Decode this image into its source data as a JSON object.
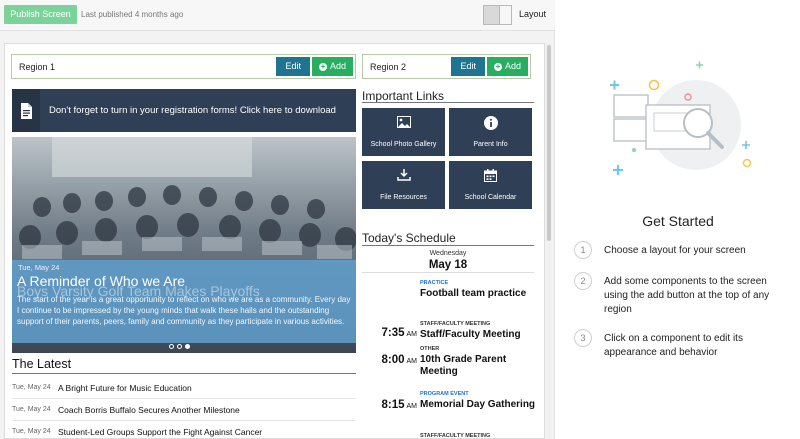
{
  "toolbar": {
    "publish_label": "Publish Screen",
    "last_published": "Last published 4 months ago",
    "layout_label": "Layout"
  },
  "regions": [
    {
      "title": "Region 1",
      "edit_label": "Edit",
      "add_label": "Add"
    },
    {
      "title": "Region 2",
      "edit_label": "Edit",
      "add_label": "Add"
    }
  ],
  "announcement": {
    "text": "Don't forget to turn in your registration forms! Click here to download",
    "icon": "document-icon"
  },
  "slideshow": {
    "date": "Tue, May 24",
    "title": "A Reminder of Who we Are",
    "title_ghost": "Boys Varsity Golf Team Makes Playoffs",
    "body": "The start of the year is a great opportunity to reflect on who we are as a community. Every day I continue to be impressed by the young minds that walk these halls and the outstanding support of their parents, peers, family and community as they participate in various activities.",
    "dots": 3,
    "active_dot": 3
  },
  "latest": {
    "heading": "The Latest",
    "items": [
      {
        "date": "Tue, May 24",
        "title": "A Bright Future for Music Education"
      },
      {
        "date": "Tue, May 24",
        "title": "Coach Borris Buffalo Secures Another Milestone"
      },
      {
        "date": "Tue, May 24",
        "title": "Student-Led Groups Support the Fight Against Cancer"
      }
    ]
  },
  "important_links": {
    "heading": "Important Links",
    "tiles": [
      {
        "label": "School Photo Gallery",
        "icon": "photo-icon"
      },
      {
        "label": "Parent Info",
        "icon": "info-icon"
      },
      {
        "label": "File Resources",
        "icon": "download-icon"
      },
      {
        "label": "School Calendar",
        "icon": "calendar-icon"
      }
    ]
  },
  "schedule": {
    "heading": "Today's Schedule",
    "day": "Wednesday",
    "date": "May 18",
    "events": [
      {
        "time": "",
        "ampm": "",
        "category": "PRACTICE",
        "category_color": "#1a73c8",
        "name": "Football team practice"
      },
      {
        "time": "7:35",
        "ampm": "AM",
        "category": "STAFF/FACULTY MEETING",
        "category_color": "#333333",
        "name": "Staff/Faculty Meeting"
      },
      {
        "time": "8:00",
        "ampm": "AM",
        "category": "OTHER",
        "category_color": "#333333",
        "name": "10th Grade Parent Meeting"
      },
      {
        "time": "8:15",
        "ampm": "AM",
        "category": "PROGRAM EVENT",
        "category_color": "#1a73c8",
        "name": "Memorial Day Gathering"
      },
      {
        "time": "",
        "ampm": "",
        "category": "STAFF/FACULTY MEETING",
        "category_color": "#333333",
        "name": ""
      }
    ]
  },
  "side_panel": {
    "title": "Get Started",
    "steps": [
      {
        "num": "1",
        "text": "Choose a layout for your screen"
      },
      {
        "num": "2",
        "text": "Add some components to the screen using the add button at the top of any region"
      },
      {
        "num": "3",
        "text": "Click on a component to edit its appearance and behavior"
      }
    ]
  },
  "colors": {
    "publish": "#7cd39a",
    "edit": "#1f7591",
    "add": "#27ae60",
    "dark_tile": "#2f3f55",
    "slide_overlay": "#609ecd"
  }
}
